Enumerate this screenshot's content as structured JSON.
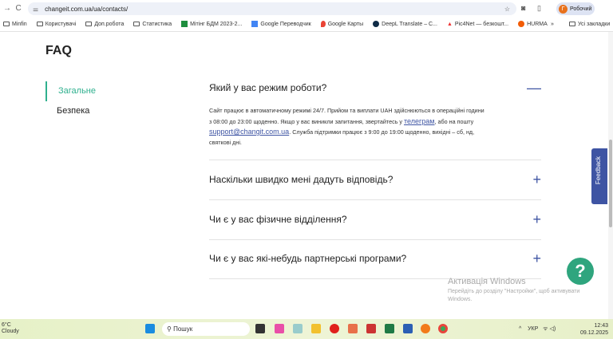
{
  "browser": {
    "url": "changeit.com.ua/ua/contacts/",
    "profile_label": "Робочий",
    "profile_initial": "Г",
    "bookmarks": [
      "Minfin",
      "Користувачі",
      "Доп.робота",
      "Статистика",
      "Мітінг БДМ 2023-2...",
      "Google Переводчик",
      "Google Карты",
      "DeepL Translate – C...",
      "Pic4Net — безкошт...",
      "HURMA"
    ],
    "more": "»",
    "all_bookmarks": "Усі закладки"
  },
  "page": {
    "title": "FAQ",
    "sidebar": [
      {
        "label": "Загальне",
        "active": true
      },
      {
        "label": "Безпека",
        "active": false
      }
    ],
    "faq": [
      {
        "question": "Який у вас режим роботи?",
        "expanded": true,
        "answer_1": "Сайт працює в автоматичному режимі 24/7. Прийом та виплати UAH здійснюються в операційні години з 08:00 до 23:00 щоденно. Якщо у вас виникли запитання, звертайтесь у ",
        "link_telegram": "телеграм",
        "answer_2": ", або на пошту ",
        "link_email": "support@changit.com.ua",
        "answer_3": ". Служба підтримки працює з 9:00 до 19:00 щоденно, вихідні – сб, нд, святкові дні."
      },
      {
        "question": "Наскільки швидко мені дадуть відповідь?",
        "expanded": false
      },
      {
        "question": "Чи є у вас фізичне відділення?",
        "expanded": false
      },
      {
        "question": "Чи є у вас які-небудь партнерські програми?",
        "expanded": false
      }
    ],
    "feedback": "Feedback",
    "help": "?"
  },
  "watermark": {
    "title": "Активація Windows",
    "subtitle": "Перейдіть до розділу \"Настройки\", щоб активувати Windows."
  },
  "taskbar": {
    "temp": "6°C",
    "weather": "Cloudy",
    "search": "Пошук",
    "lang": "УКР",
    "time": "12:43",
    "date": "09.12.2025"
  },
  "colors": {
    "accent_green": "#2fb08e",
    "accent_blue": "#3e54a3"
  }
}
